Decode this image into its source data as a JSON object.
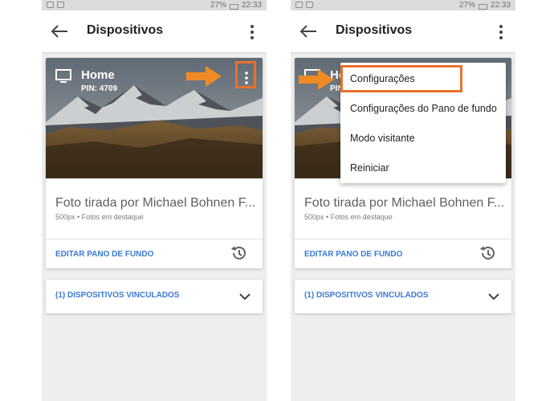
{
  "screens": [
    {
      "status": {
        "battery": "27%",
        "time": "22:33"
      },
      "title": "Dispositivos",
      "device": {
        "name": "Home",
        "pin": "PIN: 4709"
      },
      "photo": {
        "credit": "Foto tirada por Michael Bohnen F...",
        "source": "500px • Fotos em destaque"
      },
      "edit_label": "EDITAR PANO DE FUNDO",
      "linked_label": "(1) DISPOSITIVOS VINCULADOS"
    },
    {
      "status": {
        "battery": "27%",
        "time": "22:33"
      },
      "title": "Dispositivos",
      "device": {
        "name": "Home",
        "pin": "PIN: 4709"
      },
      "photo": {
        "credit": "Foto tirada por Michael Bohnen F...",
        "source": "500px • Fotos em destaque"
      },
      "edit_label": "EDITAR PANO DE FUNDO",
      "linked_label": "(1) DISPOSITIVOS VINCULADOS",
      "menu": [
        {
          "label": "Configurações"
        },
        {
          "label": "Configurações do Pano de fundo"
        },
        {
          "label": "Modo visitante"
        },
        {
          "label": "Reiniciar"
        }
      ]
    }
  ],
  "colors": {
    "accent_link": "#3a7bd5",
    "highlight": "#e8712b"
  },
  "icons": [
    "back-arrow-icon",
    "more-vert-icon",
    "tv-icon",
    "history-icon",
    "chevron-down-icon",
    "orange-arrow-icon"
  ]
}
